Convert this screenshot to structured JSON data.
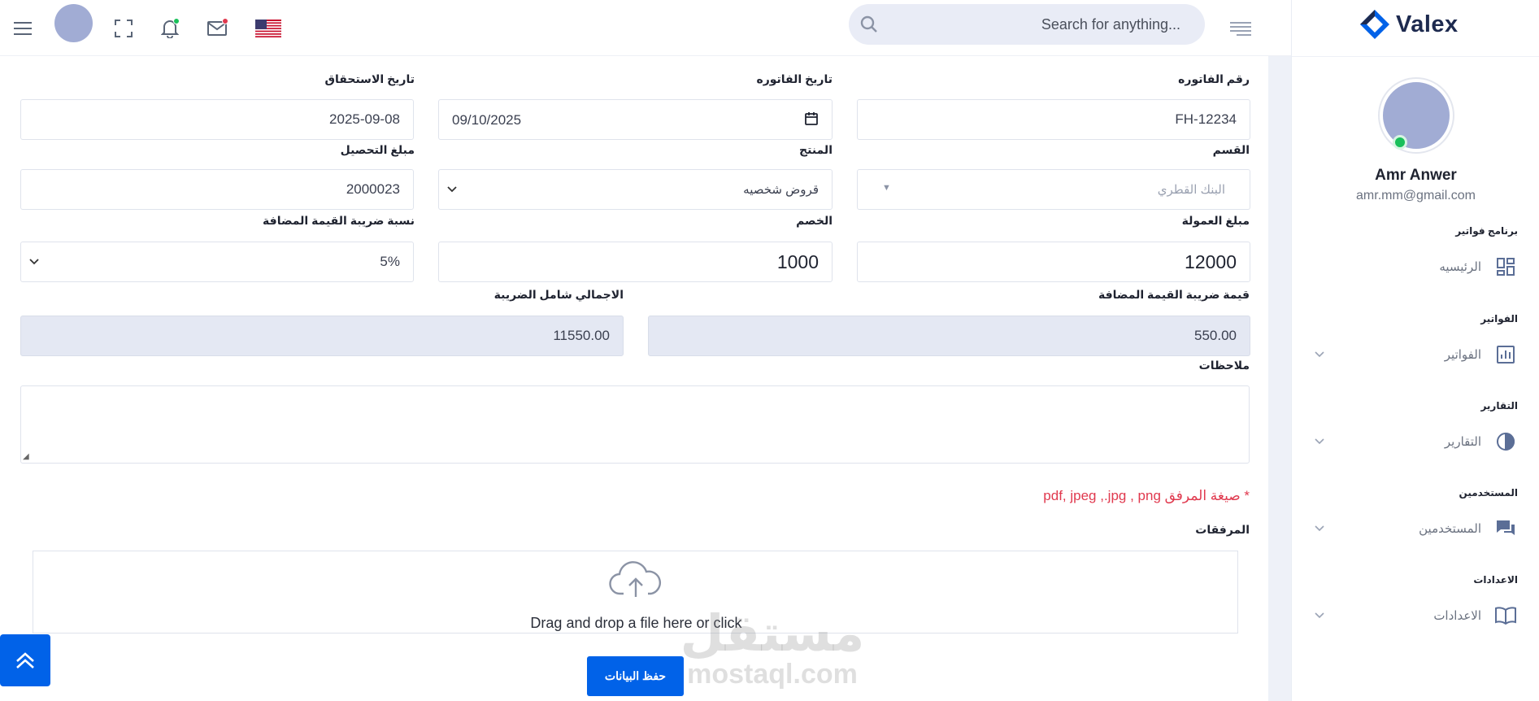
{
  "header": {
    "search_placeholder": "Search for anything...",
    "icons": [
      "menu-icon",
      "avatar",
      "fullscreen-icon",
      "bell-icon",
      "mail-icon",
      "us-flag-icon",
      "search-icon",
      "lines-icon"
    ],
    "colors": {
      "bell_dot": "#19c05a",
      "mail_dot": "#e0394e"
    }
  },
  "sidebar": {
    "logo_text": "Valex",
    "profile": {
      "name": "Amr Anwer",
      "email": "amr.mm@gmail.com"
    },
    "sections": [
      {
        "category": "برنامج فواتير",
        "item": "الرئيسيه",
        "icon": "dashboard-icon",
        "has_chevron": false
      },
      {
        "category": "الفواتير",
        "item": "الفواتير",
        "icon": "chart-icon",
        "has_chevron": true
      },
      {
        "category": "التقارير",
        "item": "التقارير",
        "icon": "pie-icon",
        "has_chevron": true
      },
      {
        "category": "المستخدمين",
        "item": "المستخدمين",
        "icon": "chat-icon",
        "has_chevron": true
      },
      {
        "category": "الاعدادات",
        "item": "الاعدادات",
        "icon": "book-icon",
        "has_chevron": true
      }
    ]
  },
  "form": {
    "invoice_number": {
      "label": "رقم الفاتوره",
      "value": "FH-12234"
    },
    "invoice_date": {
      "label": "تاريخ الفاتوره",
      "value": "09/10/2025"
    },
    "due_date": {
      "label": "تاريخ الاستحقاق",
      "value": "2025-09-08"
    },
    "section": {
      "label": "القسم",
      "placeholder": "البنك القطري"
    },
    "product": {
      "label": "المنتج",
      "value": "قروض شخصيه"
    },
    "collection_amount": {
      "label": "مبلغ التحصيل",
      "value": "2000023"
    },
    "commission_amount": {
      "label": "مبلغ العمولة",
      "value": "12000"
    },
    "discount": {
      "label": "الخصم",
      "value": "1000"
    },
    "vat_rate": {
      "label": "نسبة ضريبة القيمة المضافة",
      "value": "5%"
    },
    "vat_value": {
      "label": "قيمة ضريبة القيمة المضافة",
      "value": "550.00"
    },
    "total_with_tax": {
      "label": "الاجمالي شامل الضريبة",
      "value": "11550.00"
    },
    "notes": {
      "label": "ملاحظات"
    },
    "attachment_hint": "* صيغة المرفق pdf, jpeg ,.jpg , png",
    "attachments_label": "المرفقات",
    "dropzone_text": "Drag and drop a file here or click",
    "save_label": "حفظ البيانات"
  },
  "watermark": {
    "line1": "مستقل",
    "line2": "mostaql.com"
  },
  "colors": {
    "primary": "#0162e8",
    "readonly_bg": "#e4e8f3",
    "hint": "#e0394e",
    "avatar": "#a1acd4",
    "online": "#19c05a"
  }
}
